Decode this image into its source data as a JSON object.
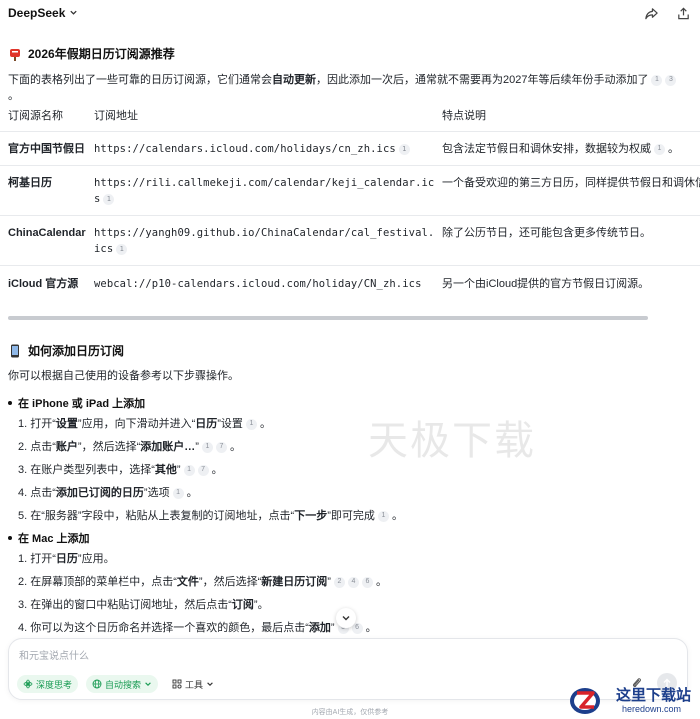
{
  "header": {
    "app_name": "DeepSeek",
    "share_icon": "share-icon",
    "more_icon": "forward-icon"
  },
  "section1": {
    "title": "2026年假期日历订阅源推荐",
    "intro_a": "下面的表格列出了一些可靠的日历订阅源，它们通常会",
    "intro_bold": "自动更新",
    "intro_b": "，因此添加一次后，通常就不需要再为2027年等后续年份手动添加了",
    "intro_cites": [
      "1",
      "3"
    ]
  },
  "table": {
    "headers": [
      "订阅源名称",
      "订阅地址",
      "特点说明"
    ],
    "rows": [
      {
        "name": "官方中国节假日",
        "url": "https://calendars.icloud.com/holidays/cn_zh.ics",
        "url_cite": "1",
        "desc": "包含法定节假日和调休安排，数据较为权威",
        "desc_cite": "1"
      },
      {
        "name": "柯基日历",
        "url_line1": "https://rili.callmekeji.com/calendar/keji_calendar.ic",
        "url_line2": "s",
        "url_cite": "1",
        "desc": "一个备受欢迎的第三方日历，同样提供节假日和调休信"
      },
      {
        "name": "ChinaCalendar",
        "url_line1": "https://yangh09.github.io/ChinaCalendar/cal_festival.",
        "url_line2": "ics",
        "url_cite": "1",
        "desc": "除了公历节日，还可能包含更多传统节日。"
      },
      {
        "name": "iCloud 官方源",
        "url": "webcal://p10-calendars.icloud.com/holiday/CN_zh.ics",
        "desc": "另一个由iCloud提供的官方节假日订阅源。"
      }
    ]
  },
  "section2": {
    "title": "如何添加日历订阅",
    "intro": "你可以根据自己使用的设备参考以下步骤操作。",
    "iphone_head": "在 iPhone 或 iPad 上添加",
    "iphone_steps": [
      {
        "pre": "1. 打开“",
        "b1": "设置",
        "mid": "”应用，向下滑动并进入“",
        "b2": "日历",
        "post": "”设置",
        "cites": [
          "1"
        ]
      },
      {
        "pre": "2. 点击“",
        "b1": "账户",
        "mid": "”，然后选择“",
        "b2": "添加账户…",
        "post": "”",
        "cites": [
          "1",
          "7"
        ]
      },
      {
        "pre": "3. 在账户类型列表中，选择“",
        "b1": "其他",
        "mid": "”",
        "b2": "",
        "post": "",
        "cites": [
          "1",
          "7"
        ]
      },
      {
        "pre": "4. 点击“",
        "b1": "添加已订阅的日历",
        "mid": "”选项",
        "b2": "",
        "post": "",
        "cites": [
          "1"
        ]
      },
      {
        "pre": "5. 在“服务器”字段中，粘贴从上表复制的订阅地址，点击“",
        "b1": "下一步",
        "mid": "”即可完成",
        "b2": "",
        "post": "",
        "cites": [
          "1"
        ]
      }
    ],
    "mac_head": "在 Mac 上添加",
    "mac_steps": [
      {
        "pre": "1. 打开“",
        "b1": "日历",
        "mid": "”应用。",
        "b2": "",
        "post": "",
        "cites": []
      },
      {
        "pre": "2. 在屏幕顶部的菜单栏中，点击“",
        "b1": "文件",
        "mid": "”，然后选择“",
        "b2": "新建日历订阅",
        "post": "”",
        "cites": [
          "2",
          "4",
          "6"
        ]
      },
      {
        "pre": "3. 在弹出的窗口中粘贴订阅地址，然后点击“",
        "b1": "订阅",
        "mid": "”。",
        "b2": "",
        "post": "",
        "cites": []
      },
      {
        "pre": "4. 你可以为这个日历命名并选择一个喜欢的颜色，最后点击“",
        "b1": "添加",
        "mid": "”",
        "b2": "",
        "post": "",
        "cites": [
          "5",
          "6"
        ]
      }
    ]
  },
  "watermark": "天极下载",
  "composer": {
    "placeholder": "和元宝说点什么",
    "chip_deep": "深度思考",
    "chip_search": "自动搜索",
    "chip_tools": "工具"
  },
  "disclaimer": "内容由AI生成，仅供参考",
  "corner_logo": {
    "cn": "这里下载站",
    "en": "heredown.com"
  },
  "colors": {
    "accent_green": "#1a9c54",
    "logo_blue": "#1d3f8c",
    "logo_red": "#d8232a"
  }
}
